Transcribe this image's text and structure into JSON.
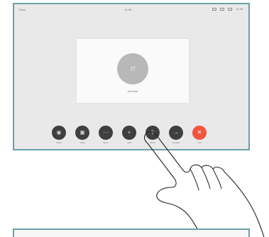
{
  "status_bar": {
    "left_text": "Cisco",
    "center_text": "14:48",
    "right_time": "14:48"
  },
  "call": {
    "avatar_initials": "JT",
    "caller_name": "Jon Doe"
  },
  "controls": [
    {
      "name": "mute",
      "icon": "mic-icon",
      "glyph": "◉",
      "label": "Mute"
    },
    {
      "name": "video",
      "icon": "camera-icon",
      "glyph": "▣",
      "label": "Video"
    },
    {
      "name": "more",
      "icon": "more-icon",
      "glyph": "⋯",
      "label": "More"
    },
    {
      "name": "add",
      "icon": "plus-icon",
      "glyph": "+",
      "label": "Add"
    },
    {
      "name": "share",
      "icon": "share-icon",
      "glyph": "⇪",
      "label": "Share"
    },
    {
      "name": "transfer",
      "icon": "arrow-right-icon",
      "glyph": "→",
      "label": "Transfer"
    },
    {
      "name": "end",
      "icon": "end-call-icon",
      "glyph": "✕",
      "label": "End"
    }
  ],
  "colors": {
    "screen_border": "#6ba0a9",
    "control_bg": "#3f3f3f",
    "end_call": "#f2553f",
    "screen_bg": "#e9e9e9"
  }
}
